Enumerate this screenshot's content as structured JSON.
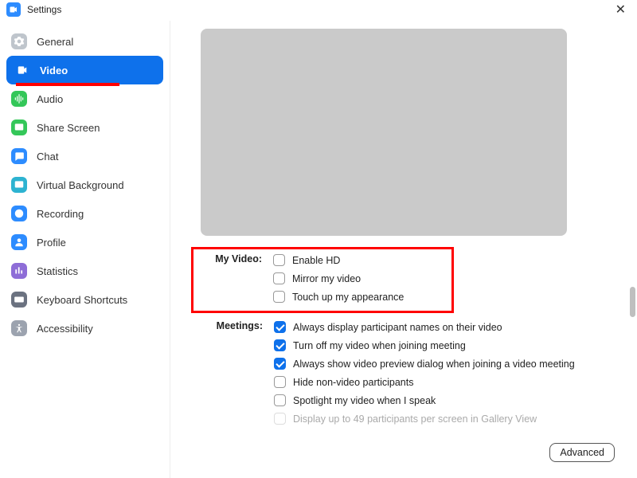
{
  "title": "Settings",
  "sidebar": {
    "items": [
      {
        "label": "General",
        "icon": "gear",
        "color": "#BFC5CC"
      },
      {
        "label": "Video",
        "icon": "video",
        "color": "#FFFFFF",
        "active": true
      },
      {
        "label": "Audio",
        "icon": "audio",
        "color": "#34C759"
      },
      {
        "label": "Share Screen",
        "icon": "share",
        "color": "#34C759"
      },
      {
        "label": "Chat",
        "icon": "chat",
        "color": "#2D8CFF"
      },
      {
        "label": "Virtual Background",
        "icon": "bg",
        "color": "#2DB3D1"
      },
      {
        "label": "Recording",
        "icon": "record",
        "color": "#2D8CFF"
      },
      {
        "label": "Profile",
        "icon": "profile",
        "color": "#2D8CFF"
      },
      {
        "label": "Statistics",
        "icon": "stats",
        "color": "#8E6DD7"
      },
      {
        "label": "Keyboard Shortcuts",
        "icon": "keyboard",
        "color": "#6B7280"
      },
      {
        "label": "Accessibility",
        "icon": "access",
        "color": "#9CA3AF"
      }
    ]
  },
  "sections": {
    "my_video": {
      "label": "My Video:",
      "options": [
        {
          "label": "Enable HD",
          "checked": false
        },
        {
          "label": "Mirror my video",
          "checked": false
        },
        {
          "label": "Touch up my appearance",
          "checked": false
        }
      ]
    },
    "meetings": {
      "label": "Meetings:",
      "options": [
        {
          "label": "Always display participant names on their video",
          "checked": true
        },
        {
          "label": "Turn off my video when joining meeting",
          "checked": true
        },
        {
          "label": "Always show video preview dialog when joining a video meeting",
          "checked": true
        },
        {
          "label": "Hide non-video participants",
          "checked": false
        },
        {
          "label": "Spotlight my video when I speak",
          "checked": false
        },
        {
          "label": "Display up to 49 participants per screen in Gallery View",
          "checked": false,
          "disabled": true
        }
      ]
    }
  },
  "advanced_button": "Advanced"
}
